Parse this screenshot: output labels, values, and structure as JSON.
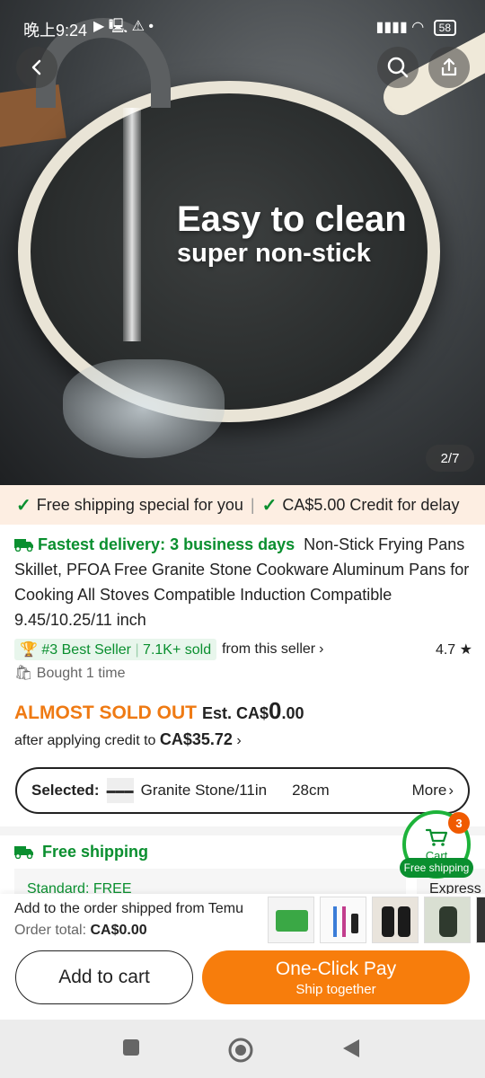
{
  "status_bar": {
    "time": "晚上9:24",
    "battery": "58"
  },
  "hero": {
    "caption_main": "Easy to clean",
    "caption_sub": "super non-stick",
    "image_counter": "2/7"
  },
  "promo": {
    "free_shipping": "Free shipping special for you",
    "credit": "CA$5.00 Credit for delay"
  },
  "product": {
    "delivery": "Fastest delivery: 3 business days",
    "title": "Non-Stick Frying Pans Skillet, PFOA Free Granite Stone Cookware Aluminum Pans for Cooking All Stoves Compatible Induction Compatible 9.45/10.25/11 inch",
    "best_seller": "#3 Best Seller",
    "sold": "7.1K+ sold",
    "from_seller": "from this seller",
    "rating": "4.7",
    "bought": "Bought 1 time"
  },
  "pricing": {
    "almost_sold_out": "ALMOST SOLD OUT",
    "est_prefix": "Est. CA$",
    "est_whole": "0",
    "est_decimal": ".00",
    "after_credit": "after applying credit to",
    "credit_price": "CA$35.72"
  },
  "selection": {
    "label": "Selected:",
    "variant": "Granite Stone/11in",
    "size": "28cm",
    "more": "More"
  },
  "shipping": {
    "title": "Free shipping",
    "standard": "Standard: FREE",
    "express": "Express"
  },
  "cart_fab": {
    "label": "Cart",
    "count": "3",
    "free_shipping": "Free shipping"
  },
  "order": {
    "shipped_from": "Add to the order shipped from Temu",
    "total_label": "Order total:",
    "total_value": "CA$0.00"
  },
  "actions": {
    "add_to_cart": "Add to cart",
    "one_click": "One-Click Pay",
    "ship_together": "Ship together"
  }
}
